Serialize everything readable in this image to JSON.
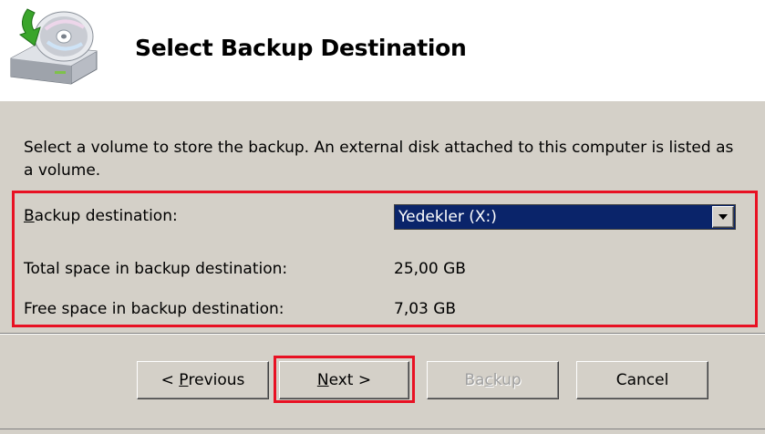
{
  "header": {
    "title": "Select Backup Destination",
    "icon": "backup-disk-icon"
  },
  "description": "Select a volume to store the backup. An external disk attached to this computer is listed as a volume.",
  "destination": {
    "label_mnemonic": "B",
    "label_rest": "ackup destination:",
    "selected": "Yedekler (X:)"
  },
  "total_space": {
    "label": "Total space in backup destination:",
    "value": "25,00 GB"
  },
  "free_space": {
    "label": "Free space in backup destination:",
    "value": "7,03 GB"
  },
  "buttons": {
    "previous_prefix": "< ",
    "previous_mnemonic": "P",
    "previous_rest": "revious",
    "next_mnemonic": "N",
    "next_rest": "ext >",
    "backup_prefix": "Ba",
    "backup_mnemonic": "c",
    "backup_rest": "kup",
    "cancel": "Cancel"
  },
  "colors": {
    "highlight": "#e81123",
    "selection": "#0a246a",
    "dialog_bg": "#d4d0c8"
  }
}
